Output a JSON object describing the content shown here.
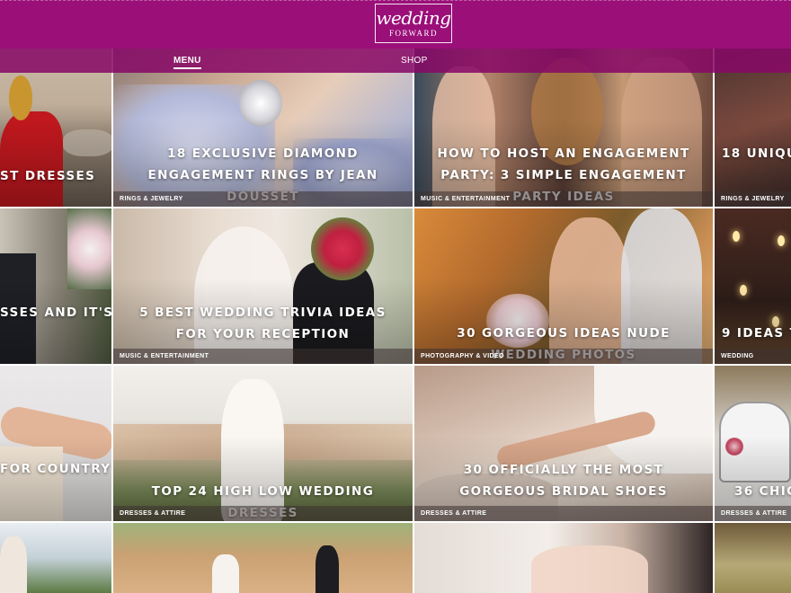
{
  "header": {
    "logo_line1": "wedding",
    "logo_line2": "FORWARD",
    "nav": {
      "menu": "MENU",
      "shop": "SHOP"
    }
  },
  "colors": {
    "brand": "#9b0f79",
    "nav_overlay": "#870866",
    "category_bar": "#3c3232"
  },
  "articles": [
    {
      "title": "ST DRESSES",
      "category": ""
    },
    {
      "title": "18 EXCLUSIVE DIAMOND ENGAGEMENT RINGS BY JEAN DOUSSET",
      "category": "RINGS & JEWELRY"
    },
    {
      "title": "HOW TO HOST AN ENGAGEMENT PARTY: 3 SIMPLE ENGAGEMENT PARTY IDEAS",
      "category": "MUSIC & ENTERTAINMENT"
    },
    {
      "title": "18 UNIQUE",
      "category": "RINGS & JEWELRY"
    },
    {
      "title": "SSES AND IT'S",
      "category": ""
    },
    {
      "title": "5 BEST WEDDING TRIVIA IDEAS FOR YOUR RECEPTION",
      "category": "MUSIC & ENTERTAINMENT"
    },
    {
      "title": "30 GORGEOUS IDEAS NUDE WEDDING PHOTOS",
      "category": "PHOTOGRAPHY & VIDEO"
    },
    {
      "title": "9 IDEAS TO",
      "category": "WEDDING PLANNING"
    },
    {
      "title": "FOR COUNTRY",
      "category": ""
    },
    {
      "title": "TOP 24 HIGH LOW WEDDING DRESSES",
      "category": "DRESSES & ATTIRE"
    },
    {
      "title": "30 OFFICIALLY THE MOST GORGEOUS BRIDAL SHOES",
      "category": "DRESSES & ATTIRE"
    },
    {
      "title": "36 CHIC",
      "category": "DRESSES & ATTIRE"
    },
    {
      "title": "",
      "category": ""
    },
    {
      "title": "",
      "category": ""
    },
    {
      "title": "",
      "category": ""
    },
    {
      "title": "",
      "category": ""
    }
  ]
}
